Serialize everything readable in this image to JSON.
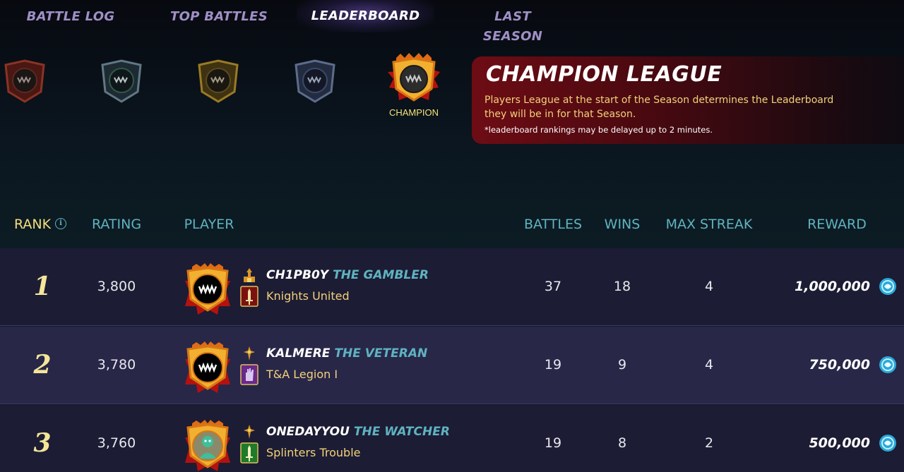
{
  "tabs": [
    {
      "label": "BATTLE LOG",
      "active": false
    },
    {
      "label": "TOP BATTLES",
      "active": false
    },
    {
      "label": "LEADERBOARD",
      "active": true
    },
    {
      "label": "LAST SEASON",
      "active": false
    }
  ],
  "leagues": {
    "icons": [
      "bronze-league-icon",
      "silver-league-icon",
      "gold-league-icon",
      "diamond-league-icon",
      "champion-league-icon"
    ],
    "selected_caption": "CHAMPION"
  },
  "panel": {
    "title": "CHAMPION LEAGUE",
    "description": "Players League at the start of the Season determines the Leaderboard they will be in for that Season.",
    "note": "*leaderboard rankings may be delayed up to 2 minutes."
  },
  "columns": {
    "rank": "RANK",
    "rating": "RATING",
    "player": "PLAYER",
    "battles": "BATTLES",
    "wins": "WINS",
    "max_streak": "MAX STREAK",
    "reward": "REWARD"
  },
  "rows": [
    {
      "rank": "1",
      "rating": "3,800",
      "player": "CH1PB0Y",
      "title": "THE GAMBLER",
      "guild": "Knights United",
      "battles": "37",
      "wins": "18",
      "max_streak": "4",
      "reward": "1,000,000"
    },
    {
      "rank": "2",
      "rating": "3,780",
      "player": "KALMERE",
      "title": "THE VETERAN",
      "guild": "T&A Legion I",
      "battles": "19",
      "wins": "9",
      "max_streak": "4",
      "reward": "750,000"
    },
    {
      "rank": "3",
      "rating": "3,760",
      "player": "ONEDAYYOU",
      "title": "THE WATCHER",
      "guild": "Splinters Trouble",
      "battles": "19",
      "wins": "8",
      "max_streak": "2",
      "reward": "500,000"
    }
  ],
  "colors": {
    "accent_teal": "#5fb3c0",
    "gold_text": "#f3d27a",
    "tab_inactive": "#a08fc6",
    "panel_red": "#6e0c14"
  }
}
